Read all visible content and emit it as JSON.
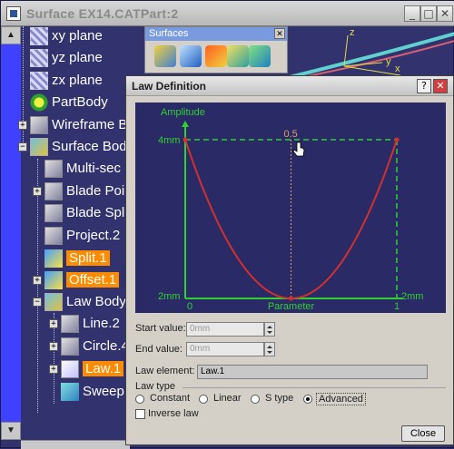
{
  "window": {
    "title": "Surface EX14.CATPart:2"
  },
  "tree": {
    "items": [
      {
        "label": "xy plane",
        "icon": "plane-icon",
        "highlight": false
      },
      {
        "label": "yz plane",
        "icon": "plane-icon",
        "highlight": false
      },
      {
        "label": "zx plane",
        "icon": "plane-icon",
        "highlight": false
      },
      {
        "label": "PartBody",
        "icon": "gear-icon",
        "highlight": false
      },
      {
        "label": "Wireframe B",
        "icon": "wireframe-icon",
        "highlight": false
      },
      {
        "label": "Surface Bod",
        "icon": "surface-icon",
        "highlight": false
      },
      {
        "label": "Multi-sec",
        "icon": "multisection-icon",
        "highlight": false
      },
      {
        "label": "Blade Poi",
        "icon": "blade-icon",
        "highlight": false
      },
      {
        "label": "Blade Spl",
        "icon": "blade-icon",
        "highlight": false
      },
      {
        "label": "Project.2",
        "icon": "project-icon",
        "highlight": false
      },
      {
        "label": "Split.1",
        "icon": "split-icon",
        "highlight": true
      },
      {
        "label": "Offset.1",
        "icon": "offset-icon",
        "highlight": true
      },
      {
        "label": "Law Body",
        "icon": "surface-icon",
        "highlight": false
      },
      {
        "label": "Line.2",
        "icon": "line-icon",
        "highlight": false
      },
      {
        "label": "Circle.4",
        "icon": "circle-icon",
        "highlight": false
      },
      {
        "label": "Law.1",
        "icon": "law-icon",
        "highlight": true
      },
      {
        "label": "Sweep",
        "icon": "sweep-icon",
        "highlight": false
      }
    ]
  },
  "toolbar": {
    "title": "Surfaces"
  },
  "viewport": {
    "axis_x": "x",
    "axis_y": "y",
    "axis_z": "z"
  },
  "law_dialog": {
    "title": "Law Definition",
    "help": "?",
    "graph": {
      "y_axis_label": "Amplitude",
      "x_axis_label": "Parameter",
      "y_max_label": "4mm",
      "y_min_label": "2mm",
      "x_min_label": "0",
      "x_max_label": "1",
      "x_right_label": "2mm",
      "cursor_label": "0.5",
      "colors": {
        "background": "#2a2a66",
        "axes": "#30d030",
        "curve": "#d03030",
        "guide": "#e0a060"
      },
      "curve": {
        "type": "line",
        "x": [
          0,
          0.1,
          0.2,
          0.3,
          0.4,
          0.5,
          0.6,
          0.7,
          0.8,
          0.9,
          1
        ],
        "y": [
          4,
          3.28,
          2.72,
          2.32,
          2.08,
          2,
          2.08,
          2.32,
          2.72,
          3.28,
          4
        ],
        "xlim": [
          0,
          1
        ],
        "ylim": [
          2,
          4
        ]
      }
    },
    "start_value_label": "Start value:",
    "start_value": "0mm",
    "end_value_label": "End value:",
    "end_value": "0mm",
    "law_element_label": "Law element:",
    "law_element_value": "Law.1",
    "law_type_label": "Law type",
    "law_types": [
      {
        "label": "Constant",
        "selected": false
      },
      {
        "label": "Linear",
        "selected": false
      },
      {
        "label": "S type",
        "selected": false
      },
      {
        "label": "Advanced",
        "selected": true
      }
    ],
    "inverse_law_label": "Inverse law",
    "inverse_law_checked": false,
    "close_label": "Close"
  }
}
